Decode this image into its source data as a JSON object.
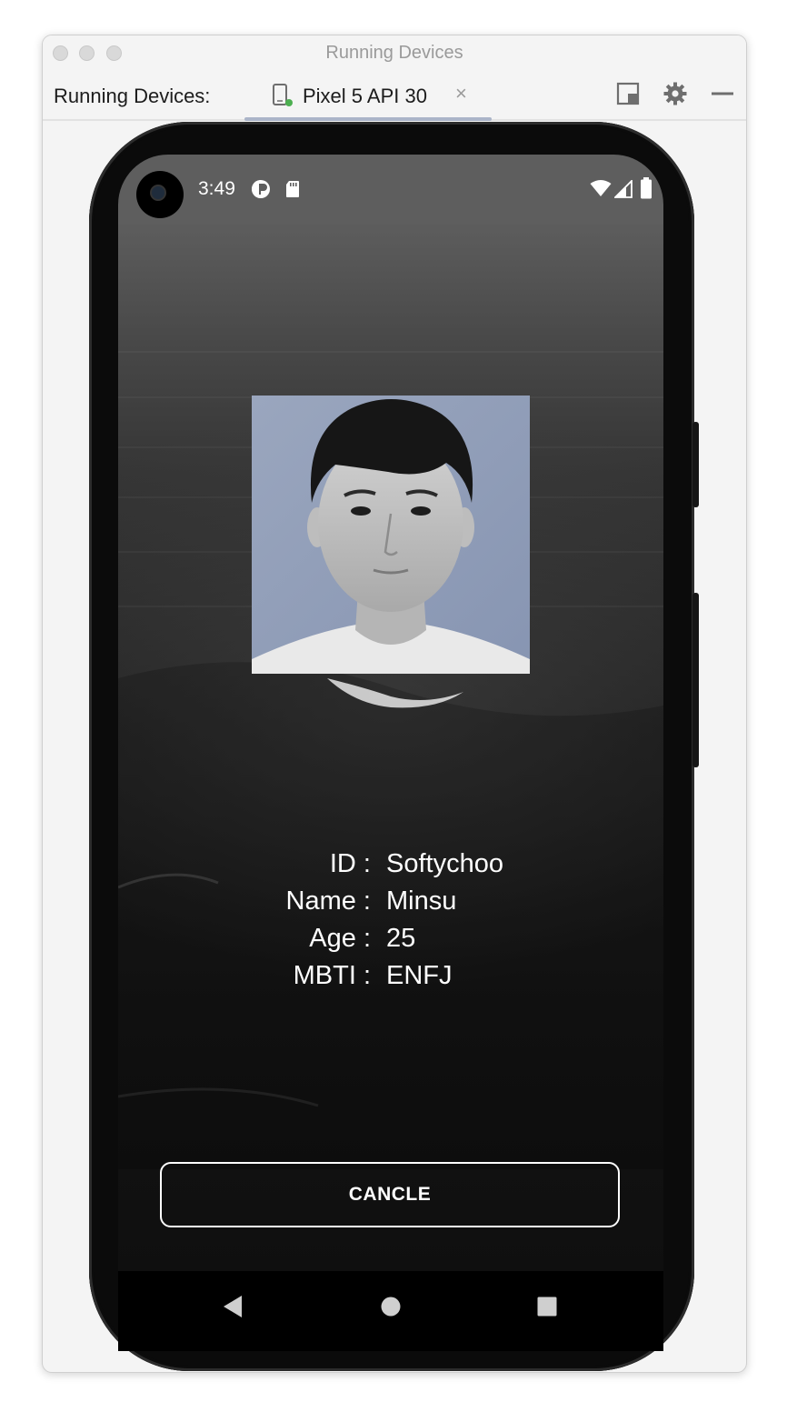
{
  "window": {
    "title": "Running Devices",
    "toolbar_label": "Running Devices:",
    "tab_label": "Pixel 5 API 30",
    "tab_close": "×"
  },
  "status_bar": {
    "time": "3:49"
  },
  "profile": {
    "rows": [
      {
        "key": "ID :",
        "value": "Softychoo"
      },
      {
        "key": "Name :",
        "value": "Minsu"
      },
      {
        "key": "Age :",
        "value": "25"
      },
      {
        "key": "MBTI :",
        "value": "ENFJ"
      }
    ]
  },
  "actions": {
    "cancel_label": "CANCLE"
  },
  "icons": {
    "window": [
      "close-icon",
      "minimize-icon",
      "zoom-icon",
      "device-icon",
      "restore-layout-icon",
      "gear-icon",
      "hide-icon"
    ],
    "status": [
      "camera-icon",
      "data-saver-icon",
      "sd-card-icon",
      "wifi-icon",
      "signal-icon",
      "battery-icon"
    ],
    "nav": [
      "back-icon",
      "home-icon",
      "recents-icon"
    ]
  }
}
